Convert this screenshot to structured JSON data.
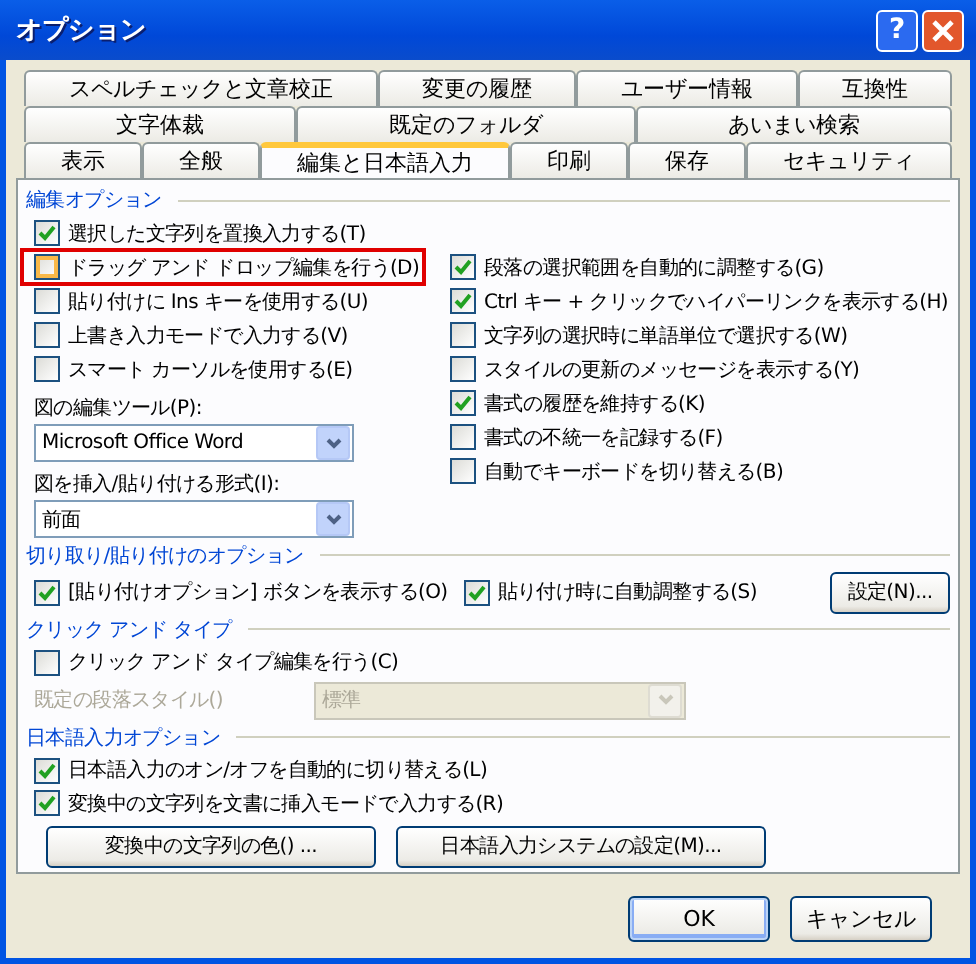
{
  "window": {
    "title": "オプション",
    "help_label": "?"
  },
  "tab_rows": [
    [
      {
        "label": "スペルチェックと文章校正",
        "selected": false
      },
      {
        "label": "変更の履歴",
        "selected": false
      },
      {
        "label": "ユーザー情報",
        "selected": false
      },
      {
        "label": "互換性",
        "selected": false
      }
    ],
    [
      {
        "label": "文字体裁",
        "selected": false
      },
      {
        "label": "既定のフォルダ",
        "selected": false
      },
      {
        "label": "あいまい検索",
        "selected": false
      }
    ],
    [
      {
        "label": "表示",
        "selected": false
      },
      {
        "label": "全般",
        "selected": false
      },
      {
        "label": "編集と日本語入力",
        "selected": true
      },
      {
        "label": "印刷",
        "selected": false
      },
      {
        "label": "保存",
        "selected": false
      },
      {
        "label": "セキュリティ",
        "selected": false
      }
    ]
  ],
  "editing_options": {
    "heading": "編集オプション",
    "left_checks": [
      {
        "label": "選択した文字列を置換入力する(T)",
        "checked": true,
        "highlighted": false
      },
      {
        "label": "ドラッグ アンド ドロップ編集を行う(D)",
        "checked": false,
        "highlighted": true
      },
      {
        "label": "貼り付けに Ins キーを使用する(U)",
        "checked": false,
        "highlighted": false
      },
      {
        "label": "上書き入力モードで入力する(V)",
        "checked": false,
        "highlighted": false
      },
      {
        "label": "スマート カーソルを使用する(E)",
        "checked": false,
        "highlighted": false
      }
    ],
    "right_checks": [
      {
        "label": "段落の選択範囲を自動的に調整する(G)",
        "checked": true
      },
      {
        "label": "Ctrl キー + クリックでハイパーリンクを表示する(H)",
        "checked": true
      },
      {
        "label": "文字列の選択時に単語単位で選択する(W)",
        "checked": false
      },
      {
        "label": "スタイルの更新のメッセージを表示する(Y)",
        "checked": false
      },
      {
        "label": "書式の履歴を維持する(K)",
        "checked": true
      },
      {
        "label": "書式の不統一を記録する(F)",
        "checked": false
      },
      {
        "label": "自動でキーボードを切り替える(B)",
        "checked": false
      }
    ],
    "dropdowns": [
      {
        "label": "図の編集ツール(P):",
        "value": "Microsoft Office Word"
      },
      {
        "label": "図を挿入/貼り付ける形式(I):",
        "value": "前面"
      }
    ]
  },
  "cut_paste": {
    "heading": "切り取り/貼り付けのオプション",
    "checks": [
      {
        "label": "[貼り付けオプション] ボタンを表示する(O)",
        "checked": true
      },
      {
        "label": "貼り付け時に自動調整する(S)",
        "checked": true
      }
    ],
    "button": "設定(N)..."
  },
  "click_and_type": {
    "heading": "クリック アンド タイプ",
    "check": {
      "label": "クリック アンド タイプ編集を行う(C)",
      "checked": false
    },
    "style": {
      "label": "既定の段落スタイル()",
      "value": "標準",
      "disabled": true
    }
  },
  "ime": {
    "heading": "日本語入力オプション",
    "checks": [
      {
        "label": "日本語入力のオン/オフを自動的に切り替える(L)",
        "checked": true
      },
      {
        "label": "変換中の文字列を文書に挿入モードで入力する(R)",
        "checked": true
      }
    ],
    "buttons": [
      "変換中の文字列の色() ...",
      "日本語入力システムの設定(M)..."
    ]
  },
  "footer_buttons": [
    "OK",
    "キャンセル"
  ]
}
